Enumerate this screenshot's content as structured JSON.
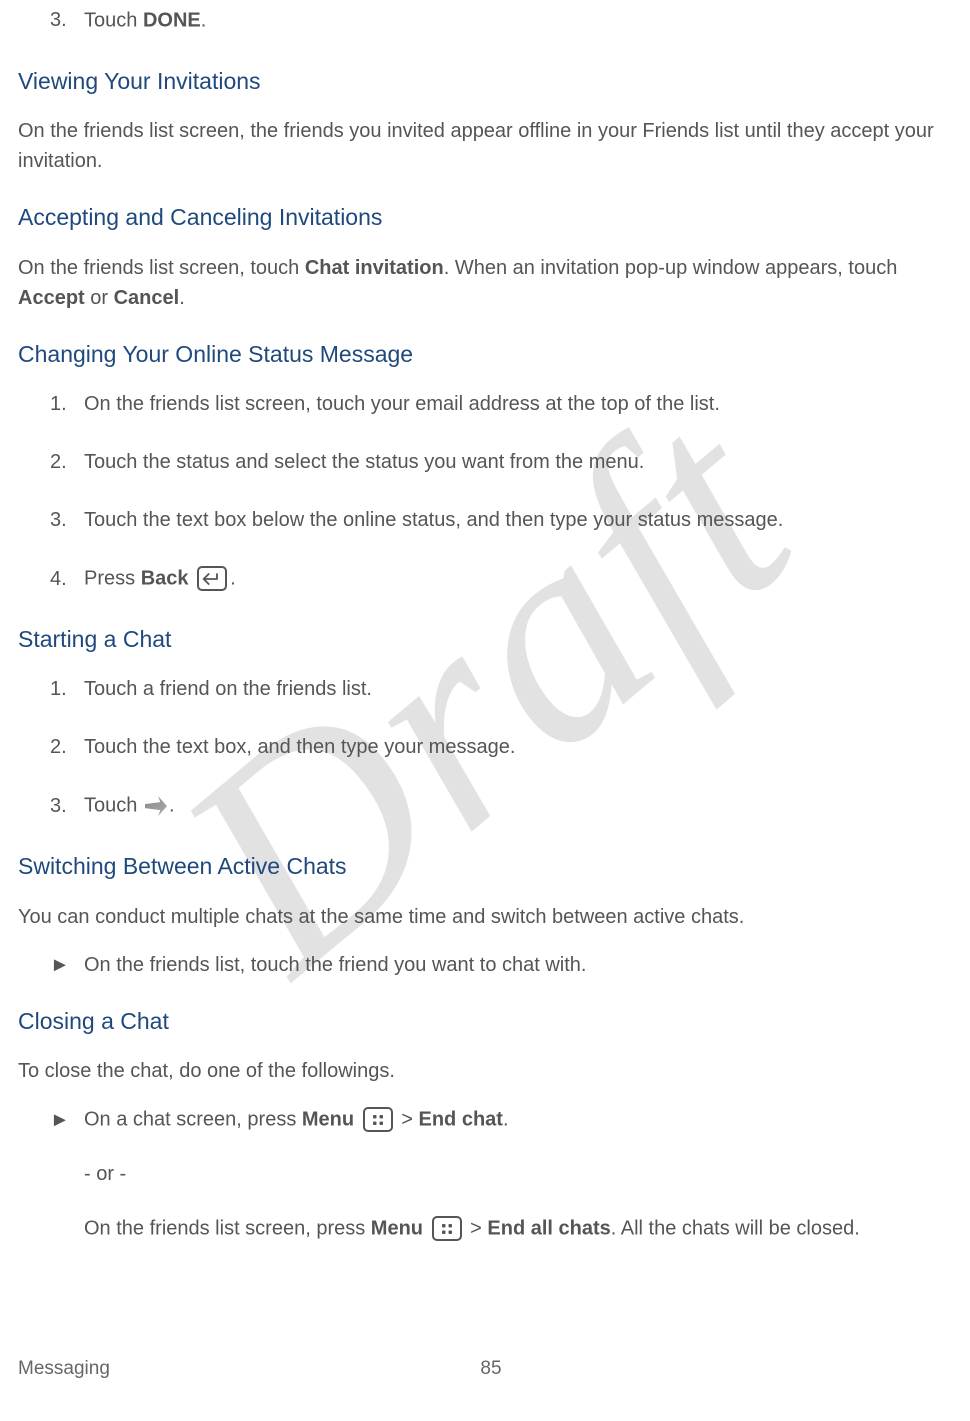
{
  "watermark": "Draft",
  "step3": {
    "num": "3.",
    "prefix": "Touch ",
    "bold": "DONE",
    "suffix": "."
  },
  "viewing": {
    "title": "Viewing Your Invitations",
    "body": "On the friends list screen, the friends you invited appear offline in your Friends list until they accept your invitation."
  },
  "accepting": {
    "title": "Accepting and Canceling Invitations",
    "body_pre": "On the friends list screen, touch ",
    "b1": "Chat invitation",
    "body_mid": ". When an invitation pop-up window appears, touch ",
    "b2": "Accept",
    "body_or": " or ",
    "b3": "Cancel",
    "body_end": "."
  },
  "changing": {
    "title": "Changing Your Online Status Message",
    "items": [
      {
        "num": "1.",
        "text": "On the friends list screen, touch your email address at the top of the list."
      },
      {
        "num": "2.",
        "text": "Touch the status and select the status you want from the menu."
      },
      {
        "num": "3.",
        "text": "Touch the text box below the online status, and then type your status message."
      }
    ],
    "item4": {
      "num": "4.",
      "pre": "Press ",
      "bold": "Back",
      "suffix": "."
    }
  },
  "starting": {
    "title": "Starting a Chat",
    "items": [
      {
        "num": "1.",
        "text": "Touch a friend on the friends list."
      },
      {
        "num": "2.",
        "text": "Touch the text box, and then type your message."
      }
    ],
    "item3": {
      "num": "3.",
      "pre": "Touch ",
      "suffix": "."
    }
  },
  "switching": {
    "title": "Switching Between Active Chats",
    "body": "You can conduct multiple chats at the same time and switch between active chats.",
    "arrow": "►",
    "itemtext": "On the friends list, touch the friend you want to chat with."
  },
  "closing": {
    "title": "Closing a Chat",
    "body": "To close the chat, do one of the followings.",
    "arrow": "►",
    "line1_pre": "On a chat screen, press ",
    "line1_b1": "Menu",
    "line1_mid": " > ",
    "line1_b2": "End chat",
    "line1_end": ".",
    "or": "- or -",
    "line2_pre": "On the friends list screen, press ",
    "line2_b1": "Menu",
    "line2_mid": " > ",
    "line2_b2": "End all chats",
    "line2_end": ". All the chats will be closed."
  },
  "footer": {
    "section": "Messaging",
    "page": "85"
  }
}
